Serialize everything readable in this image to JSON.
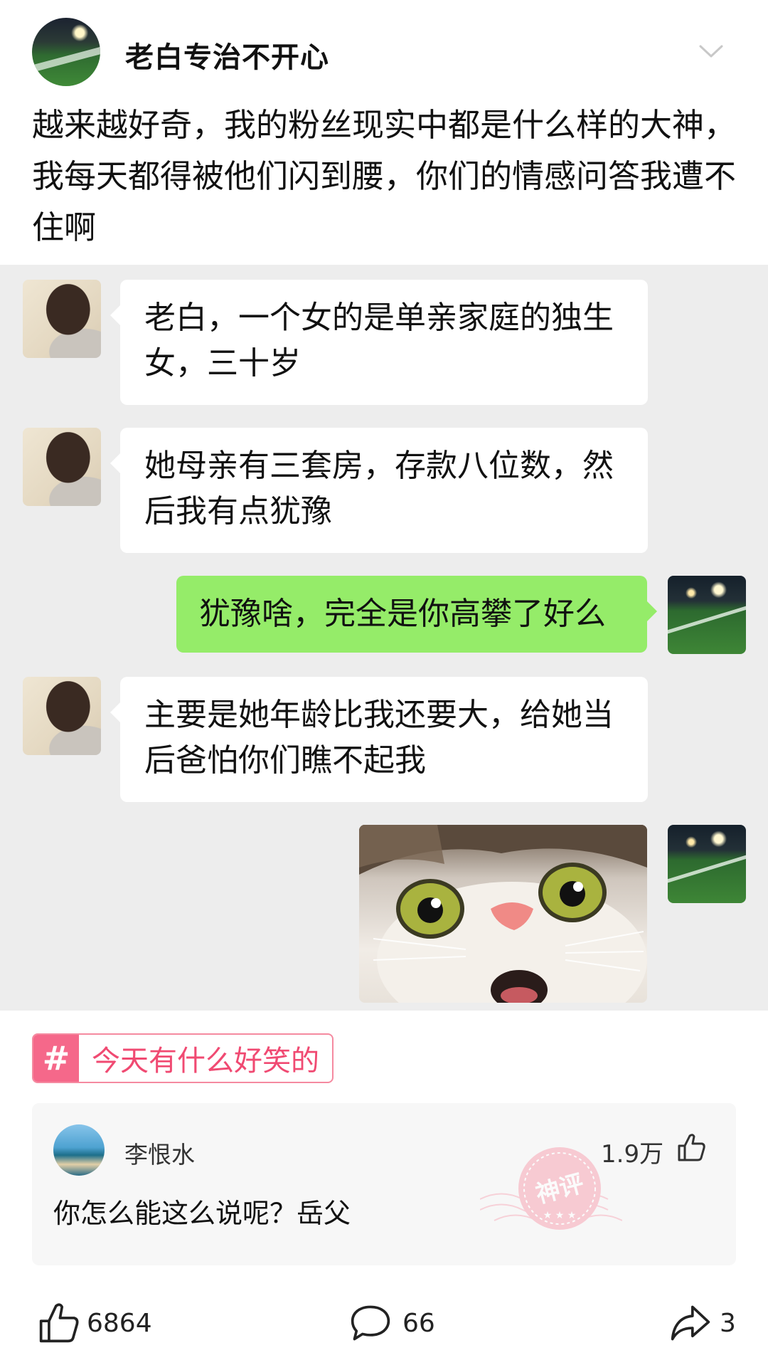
{
  "post": {
    "author": "老白专治不开心",
    "text": "越来越好奇，我的粉丝现实中都是什么样的大神，我每天都得被他们闪到腰，你们的情感问答我遭不住啊"
  },
  "chat": {
    "messages": [
      {
        "side": "left",
        "text": "老白，一个女的是单亲家庭的独生女，三十岁"
      },
      {
        "side": "left",
        "text": "她母亲有三套房，存款八位数，然后我有点犹豫"
      },
      {
        "side": "right",
        "text": "犹豫啥，完全是你高攀了好么"
      },
      {
        "side": "left",
        "text": "主要是她年龄比我还要大，给她当后爸怕你们瞧不起我"
      },
      {
        "side": "right",
        "image": "surprised-cat"
      }
    ]
  },
  "tag": {
    "hash": "#",
    "label": "今天有什么好笑的"
  },
  "top_comment": {
    "user": "李恨水",
    "text": "你怎么能这么说呢？岳父",
    "likes": "1.9万",
    "stamp": "神评"
  },
  "actions": {
    "like_count": "6864",
    "comment_count": "66",
    "share_count": "3"
  },
  "colors": {
    "chat_bg": "#ededed",
    "bubble_right": "#95ec69",
    "tag_accent": "#f5688a"
  }
}
